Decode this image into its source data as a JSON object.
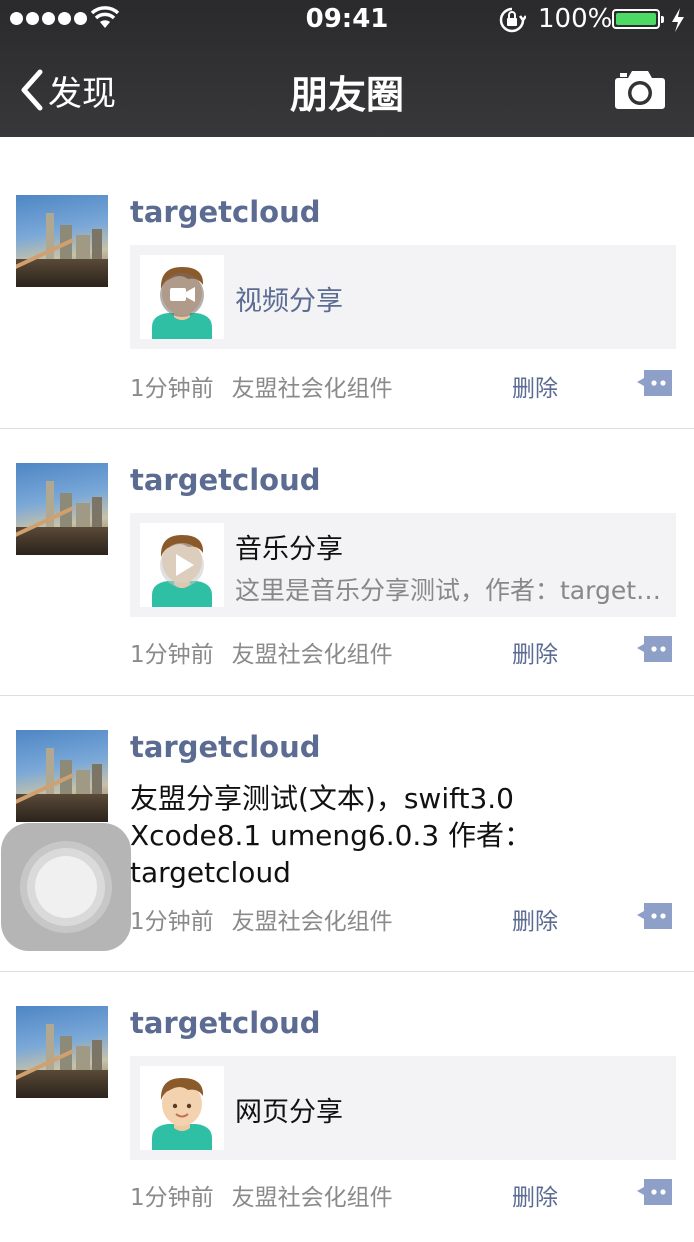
{
  "status_bar": {
    "time": "09:41",
    "battery_percent": "100%",
    "battery_level": 1.0,
    "battery_color": "#4cd964"
  },
  "nav": {
    "back_label": "发现",
    "title": "朋友圈",
    "camera_icon": "camera-icon",
    "back_icon": "chevron-left-icon"
  },
  "colors": {
    "username": "#5b6b92",
    "card_bg": "#f3f3f5",
    "nav_bg": "#2e2e30"
  },
  "posts": [
    {
      "username": "targetcloud",
      "type": "video",
      "card_title": "视频分享",
      "time_ago": "1分钟前",
      "source": "友盟社会化组件",
      "delete_label": "删除"
    },
    {
      "username": "targetcloud",
      "type": "music",
      "card_title": "音乐分享",
      "card_desc": "这里是音乐分享测试，作者：targetcloud",
      "time_ago": "1分钟前",
      "source": "友盟社会化组件",
      "delete_label": "删除"
    },
    {
      "username": "targetcloud",
      "type": "text",
      "text_lines": [
        "友盟分享测试(文本)，swift3.0",
        "Xcode8.1 umeng6.0.3 作者：",
        "targetcloud"
      ],
      "time_ago": "1分钟前",
      "source": "友盟社会化组件",
      "delete_label": "删除"
    },
    {
      "username": "targetcloud",
      "type": "webpage",
      "card_title": "网页分享",
      "time_ago": "1分钟前",
      "source": "友盟社会化组件",
      "delete_label": "删除"
    }
  ]
}
